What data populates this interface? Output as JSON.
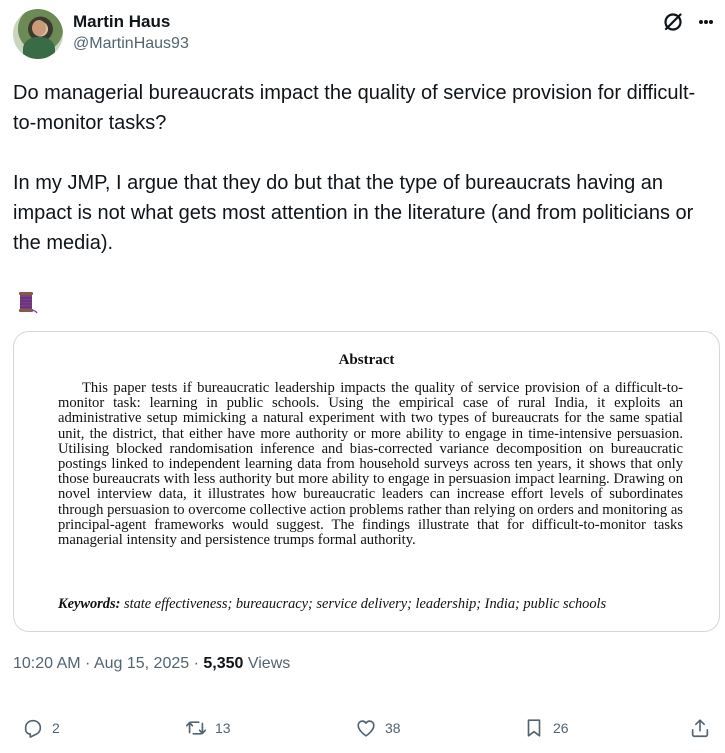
{
  "author": {
    "name": "Martin Haus",
    "handle": "@MartinHaus93"
  },
  "tweet": {
    "text": "Do managerial bureaucrats impact the quality of service provision for difficult-to-monitor tasks?\n\nIn my JMP, I argue that they do but that the type of bureaucrats having an impact is not what gets most attention in the literature (and from politicians or the media).",
    "emoji": "thread-spool-icon"
  },
  "card": {
    "title": "Abstract",
    "body": "This paper tests if bureaucratic leadership impacts the quality of service provision of a difficult-to-monitor task: learning in public schools. Using the empirical case of rural India, it exploits an administrative setup mimicking a natural experiment with two types of bureau­crats for the same spatial unit, the district, that either have more authority or more ability to engage in time-intensive persuasion. Utilising blocked randomisation inference and bias-corrected variance decomposition on bureaucratic postings linked to independent learning data from household surveys across ten years, it shows that only those bureaucrats with less authority but more ability to engage in persuasion impact learning. Drawing on novel in­terview data, it illustrates how bureaucratic leaders can increase effort levels of subordinates through persuasion to overcome collective action problems rather than relying on orders and monitoring as principal-agent frameworks would suggest. The findings illustrate that for difficult-to-monitor tasks managerial intensity and persistence trumps formal authority.",
    "keywords_label": "Keywords:",
    "keywords": "state effectiveness; bureaucracy; service delivery; leadership; India; public schools"
  },
  "meta": {
    "time": "10:20 AM",
    "sep1": " · ",
    "date": "Aug 15, 2025",
    "sep2": " · ",
    "views_count": "5,350",
    "views_label": " Views"
  },
  "actions": {
    "replies": "2",
    "reposts": "13",
    "likes": "38",
    "bookmarks": "26"
  },
  "colors": {
    "text": "#0f1419",
    "secondary": "#536471",
    "border": "#cfd9de"
  }
}
